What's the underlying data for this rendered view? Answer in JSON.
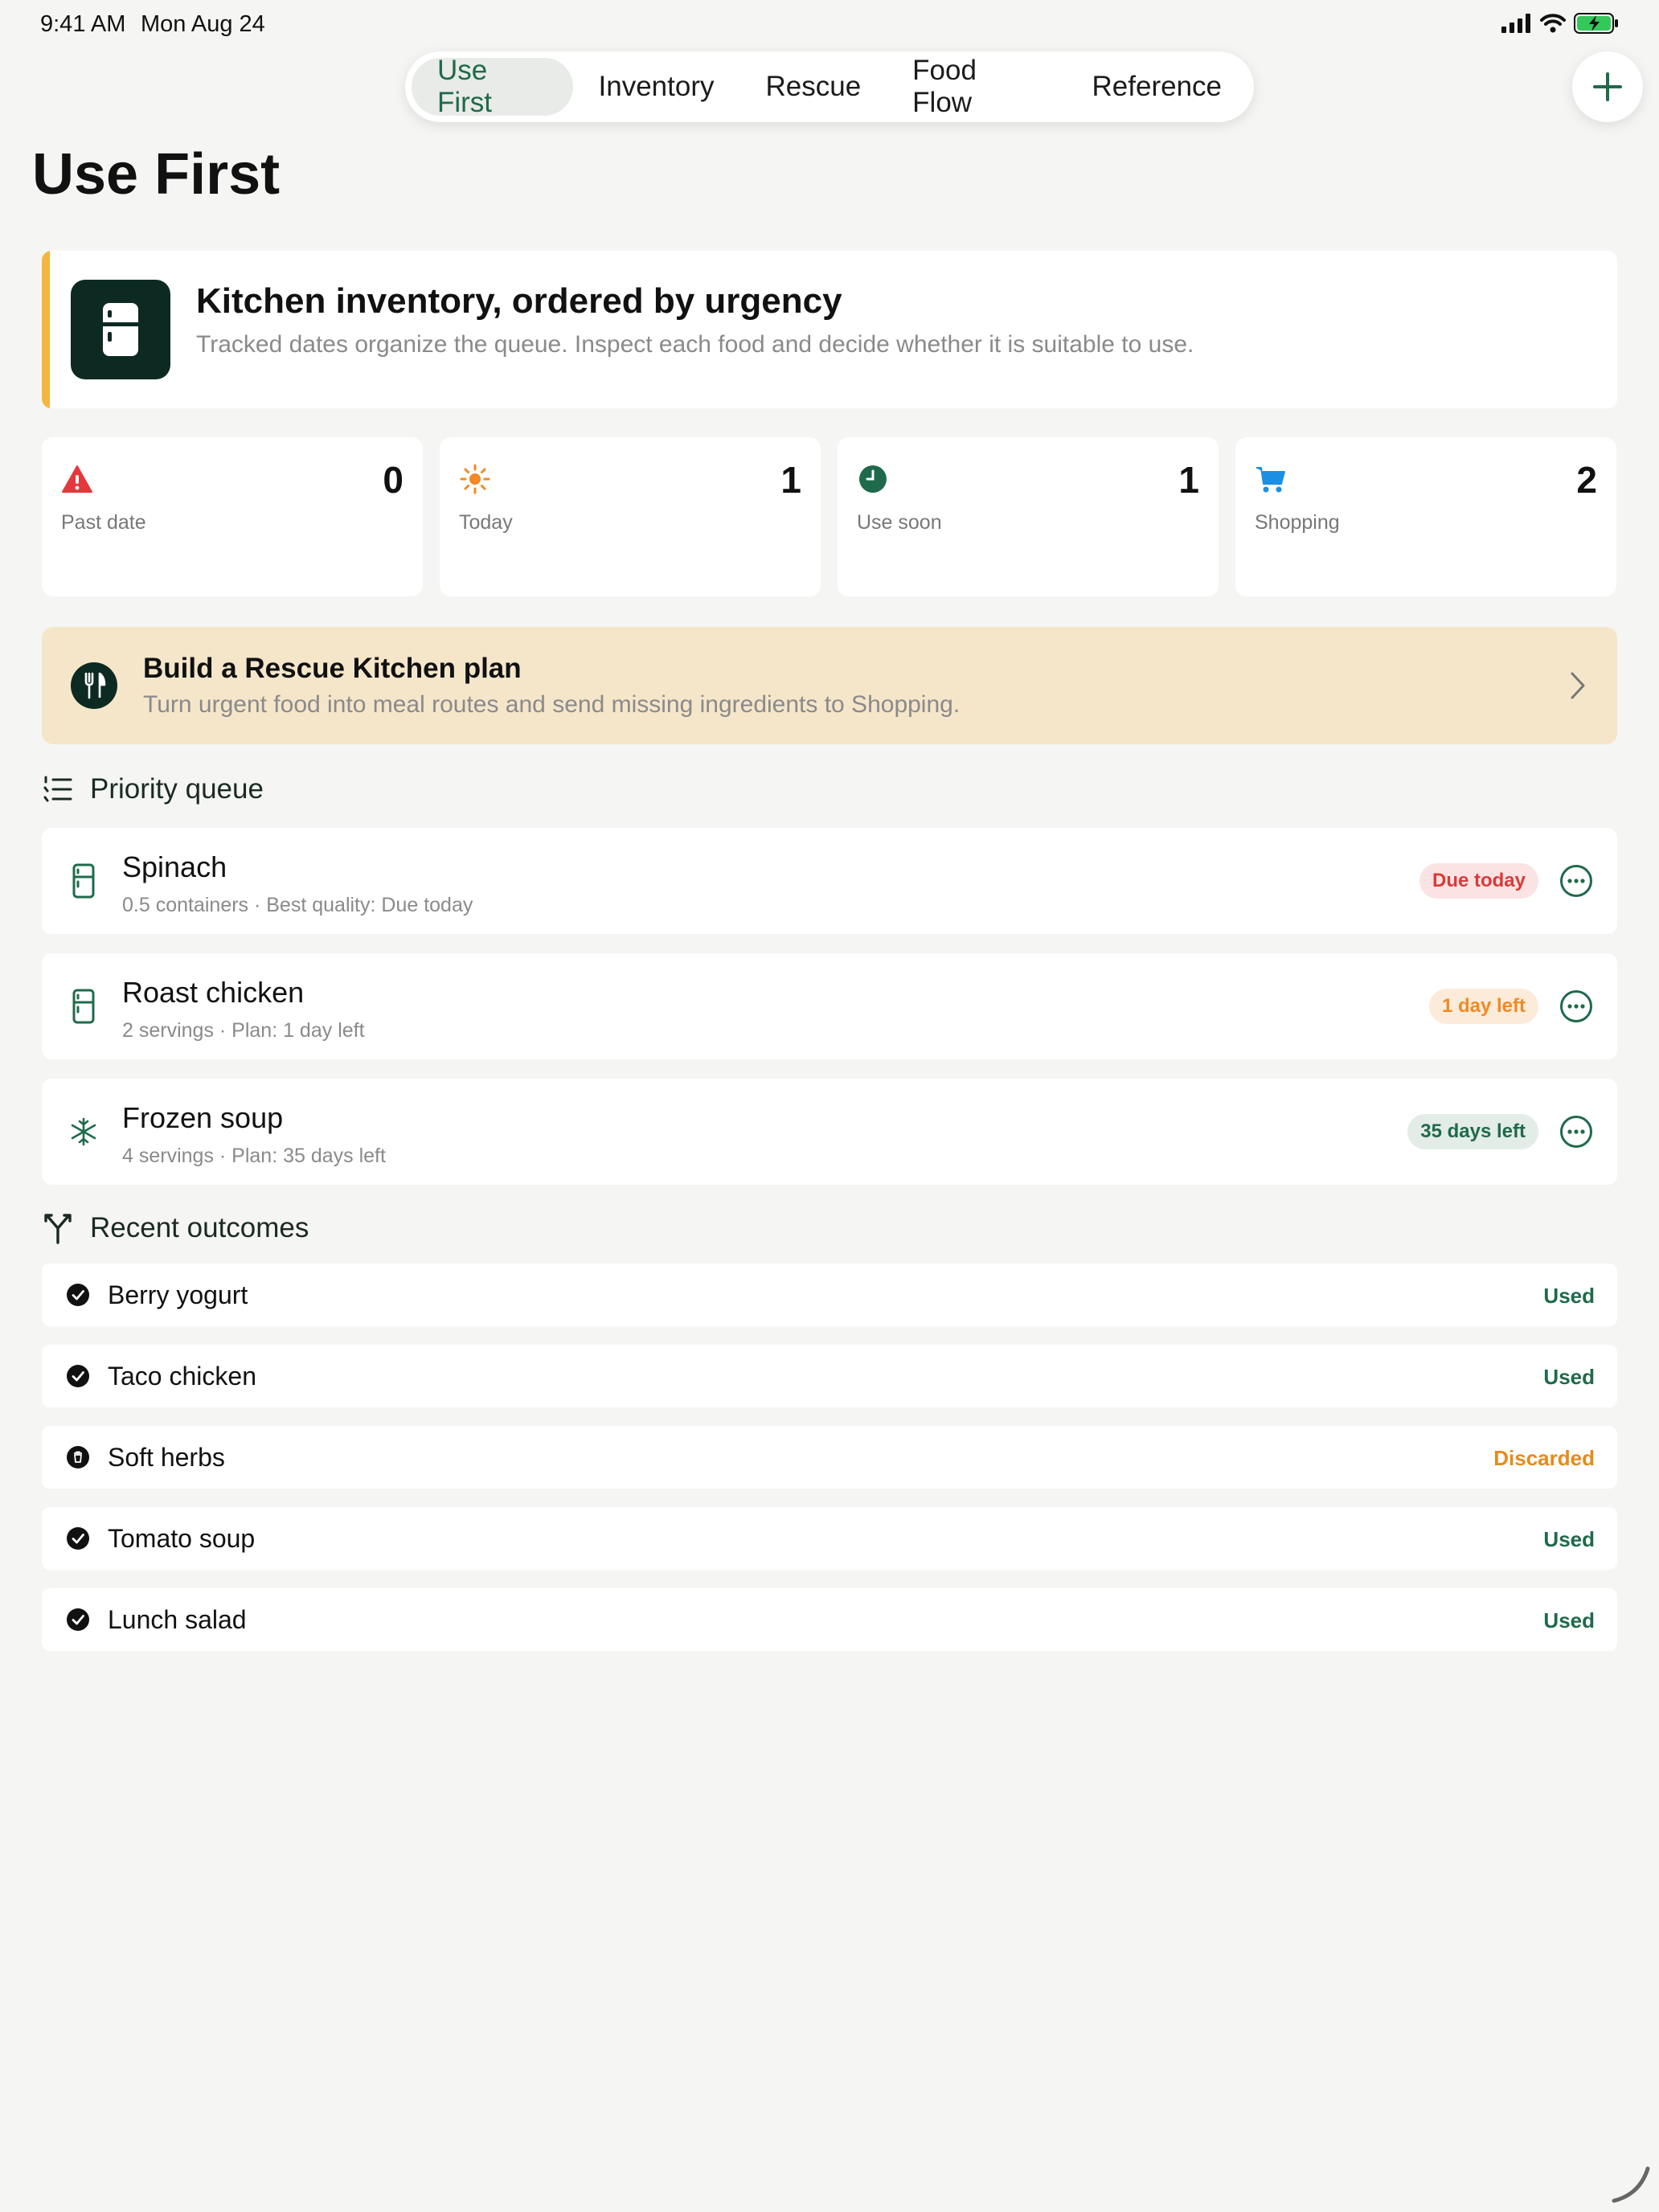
{
  "status_bar": {
    "time": "9:41 AM",
    "date": "Mon Aug 24"
  },
  "tabs": [
    {
      "label": "Use First",
      "active": true
    },
    {
      "label": "Inventory",
      "active": false
    },
    {
      "label": "Rescue",
      "active": false
    },
    {
      "label": "Food Flow",
      "active": false
    },
    {
      "label": "Reference",
      "active": false
    }
  ],
  "page_title": "Use First",
  "hero": {
    "title": "Kitchen inventory, ordered by urgency",
    "subtitle": "Tracked dates organize the queue. Inspect each food and decide whether it is suitable to use.",
    "icon": "fridge-icon"
  },
  "stats": [
    {
      "label": "Past date",
      "value": "0",
      "icon": "warning-triangle-icon",
      "color": "#e5383b"
    },
    {
      "label": "Today",
      "value": "1",
      "icon": "sun-icon",
      "color": "#f08a24"
    },
    {
      "label": "Use soon",
      "value": "1",
      "icon": "clock-icon",
      "color": "#1f6a4b"
    },
    {
      "label": "Shopping",
      "value": "2",
      "icon": "cart-icon",
      "color": "#1a8fe3"
    }
  ],
  "rescue_banner": {
    "title": "Build a Rescue Kitchen plan",
    "subtitle": "Turn urgent food into meal routes and send missing ingredients to Shopping.",
    "icon": "fork-knife-icon"
  },
  "priority_queue": {
    "title": "Priority queue",
    "items": [
      {
        "name": "Spinach",
        "meta": "0.5 containers · Best quality: Due today",
        "badge": "Due today",
        "icon": "fridge-icon"
      },
      {
        "name": "Roast chicken",
        "meta": "2 servings · Plan: 1 day left",
        "badge": "1 day left",
        "icon": "fridge-icon"
      },
      {
        "name": "Frozen soup",
        "meta": "4 servings · Plan: 35 days left",
        "badge": "35 days left",
        "icon": "snowflake-icon"
      }
    ]
  },
  "recent_outcomes": {
    "title": "Recent outcomes",
    "items": [
      {
        "name": "Berry yogurt",
        "status": "Used",
        "icon": "check-circle-icon"
      },
      {
        "name": "Taco chicken",
        "status": "Used",
        "icon": "check-circle-icon"
      },
      {
        "name": "Soft herbs",
        "status": "Discarded",
        "icon": "trash-circle-icon"
      },
      {
        "name": "Tomato soup",
        "status": "Used",
        "icon": "check-circle-icon"
      },
      {
        "name": "Lunch salad",
        "status": "Used",
        "icon": "check-circle-icon"
      }
    ]
  },
  "colors": {
    "accent_green": "#1f6a4b",
    "hero_accent": "#f4b63e",
    "banner_bg": "#f5e6ca",
    "badge_red": "#d93a3a",
    "badge_orange": "#f08a24",
    "used_green": "#1f6a4b",
    "discarded_orange": "#e88a1a"
  }
}
